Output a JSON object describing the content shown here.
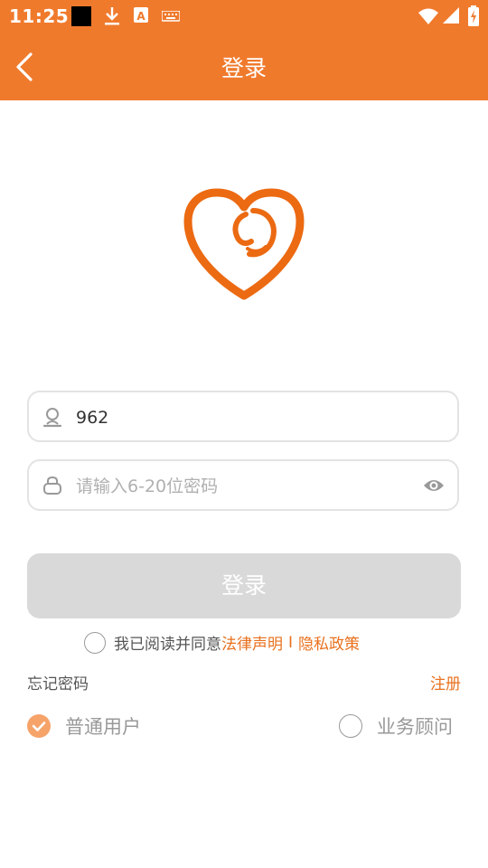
{
  "status_bar": {
    "time": "11:25"
  },
  "header": {
    "title": "登录"
  },
  "form": {
    "username_value": "962",
    "password_placeholder": "请输入6-20位密码",
    "login_label": "登录"
  },
  "agreement": {
    "text": "我已阅读并同意",
    "legal_link": "法律声明",
    "separator": "I",
    "privacy_link": "隐私政策"
  },
  "links": {
    "forgot_password": "忘记密码",
    "register": "注册"
  },
  "roles": [
    {
      "label": "普通用户",
      "selected": true
    },
    {
      "label": "业务顾问",
      "selected": false
    }
  ],
  "colors": {
    "brand": "#F07A2C",
    "link": "#E8711F",
    "disabled_button": "#d9d9d9"
  }
}
